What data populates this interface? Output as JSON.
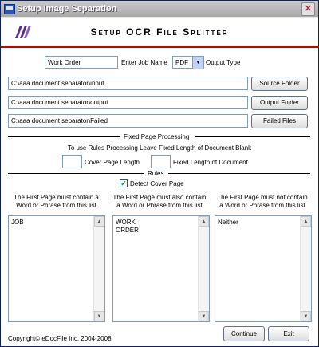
{
  "window": {
    "title": "Setup Image Separation",
    "close_glyph": "✕"
  },
  "header": {
    "title": "Setup OCR File Splitter"
  },
  "job": {
    "name_value": "Work Order",
    "name_label": "Enter Job Name",
    "output_type_value": "PDF",
    "output_type_label": "Output Type"
  },
  "folders": [
    {
      "path": "C:\\aaa document separator\\input",
      "button": "Source Folder"
    },
    {
      "path": "C:\\aaa document separator\\output",
      "button": "Output Folder"
    },
    {
      "path": "C:\\aaa document separator\\Failed",
      "button": "Failed Files"
    }
  ],
  "fixed": {
    "section_title": "Fixed Page Processing",
    "instructions": "To use Rules Processing Leave Fixed Length of Document Blank",
    "cover_length_value": "",
    "cover_length_label": "Cover Page Length",
    "fixed_length_value": "",
    "fixed_length_label": "Fixed Length of Document"
  },
  "rules": {
    "section_title": "Rules",
    "detect_cover_label": "Detect Cover Page",
    "detect_cover_checked": true,
    "columns": [
      {
        "label_line1": "The First Page must contain a",
        "label_line2": "Word or Phrase from this list",
        "lines": [
          "JOB"
        ]
      },
      {
        "label_line1": "The First Page must also contain",
        "label_line2": "a Word or Phrase from this list",
        "lines": [
          "WORK",
          "ORDER"
        ]
      },
      {
        "label_line1": "The First Page must not contain",
        "label_line2": "a Word or Phrase from this list",
        "lines": [
          "Neither"
        ]
      }
    ]
  },
  "footer": {
    "copyright": "Copyright© eDocFile Inc. 2004-2008",
    "continue_label": "Continue",
    "exit_label": "Exit"
  },
  "colors": {
    "accent_red": "#c00000",
    "logo_purple": "#5b2a86",
    "title_bar": "#a9a9a9"
  },
  "icons": {
    "app": "window-app-icon",
    "logo": "edocfile-logo-icon",
    "close": "close-icon",
    "check": "check-icon"
  }
}
